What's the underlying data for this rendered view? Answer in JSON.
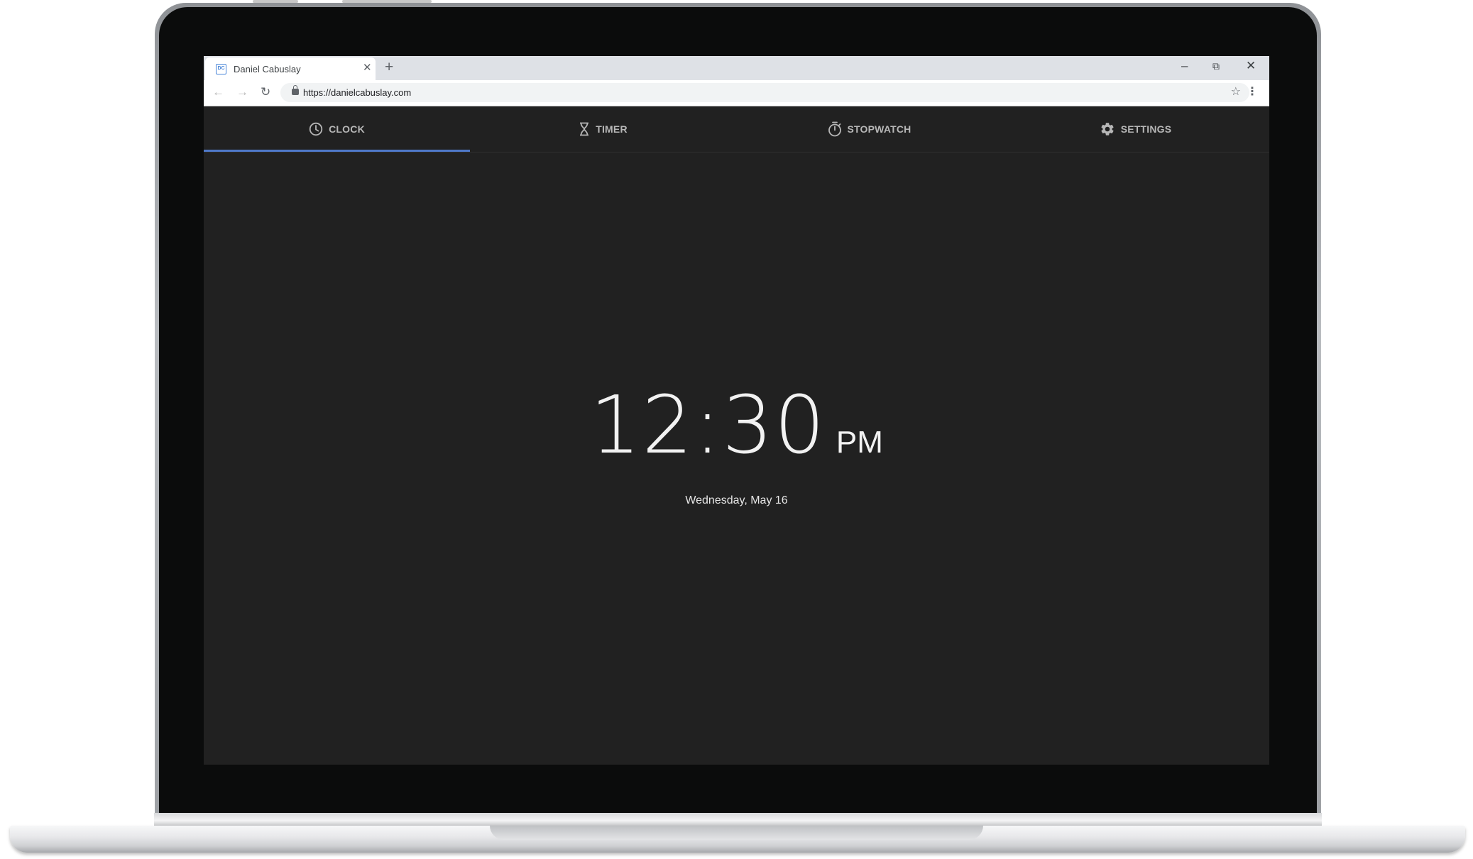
{
  "browser": {
    "tab_title": "Daniel Cabuslay",
    "favicon_text": "DC",
    "url": "https://danielcabuslay.com"
  },
  "app_tabs": [
    {
      "label": "CLOCK",
      "icon": "clock-icon"
    },
    {
      "label": "TIMER",
      "icon": "hourglass-icon"
    },
    {
      "label": "STOPWATCH",
      "icon": "stopwatch-icon"
    },
    {
      "label": "SETTINGS",
      "icon": "gear-icon"
    }
  ],
  "selected_tab": "CLOCK",
  "clock": {
    "time": "12:30",
    "period": "PM",
    "date": "Wednesday, May 16"
  },
  "colors": {
    "background": "#212121",
    "accent": "#4f79c9",
    "tab_text": "#b7b7b7"
  }
}
